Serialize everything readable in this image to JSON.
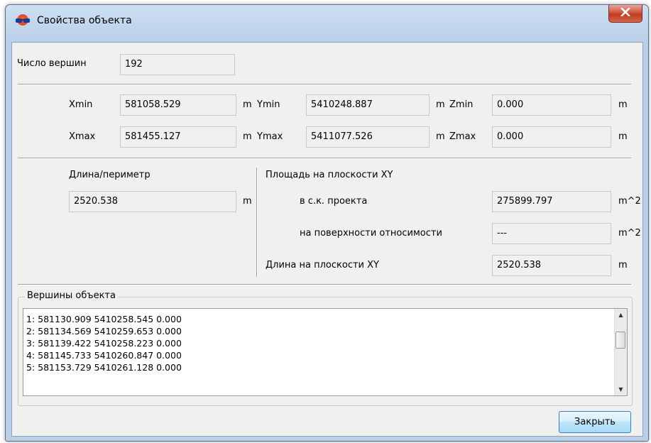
{
  "window": {
    "title": "Свойства объекта"
  },
  "vertex_count": {
    "label": "Число вершин",
    "value": "192"
  },
  "bounds": {
    "xmin": {
      "label": "Xmin",
      "value": "581058.529",
      "unit": "m"
    },
    "ymin": {
      "label": "Ymin",
      "value": "5410248.887",
      "unit": "m"
    },
    "zmin": {
      "label": "Zmin",
      "value": "0.000",
      "unit": "m"
    },
    "xmax": {
      "label": "Xmax",
      "value": "581455.127",
      "unit": "m"
    },
    "ymax": {
      "label": "Ymax",
      "value": "5411077.526",
      "unit": "m"
    },
    "zmax": {
      "label": "Zmax",
      "value": "0.000",
      "unit": "m"
    }
  },
  "length": {
    "label": "Длина/периметр",
    "value": "2520.538",
    "unit": "m"
  },
  "area": {
    "heading": "Площадь на плоскости XY",
    "project_cs": {
      "label": "в с.к. проекта",
      "value": "275899.797",
      "unit": "m^2"
    },
    "relative_surface": {
      "label": "на поверхности относимости",
      "value": "---",
      "unit": "m^2"
    },
    "xy_length": {
      "label": "Длина на плоскости XY",
      "value": "2520.538",
      "unit": "m"
    }
  },
  "vertices": {
    "title": "Вершины объекта",
    "items": [
      "1: 581130.909 5410258.545 0.000",
      "2: 581134.569 5410259.653 0.000",
      "3: 581139.422 5410258.223 0.000",
      "4: 581145.733 5410260.847 0.000",
      "5: 581153.729 5410261.128 0.000"
    ]
  },
  "buttons": {
    "close": "Закрыть"
  },
  "icons": {
    "app": "globe-glasses-icon",
    "close": "close-x-icon",
    "scroll_up": "scroll-up-arrow-icon",
    "scroll_down": "scroll-down-arrow-icon"
  },
  "colors": {
    "close_button_red": "#c03a22",
    "title_bar": "#c1d5ec",
    "dialog_bg": "#f0f0f0",
    "button_blue": "#bee6fd"
  }
}
